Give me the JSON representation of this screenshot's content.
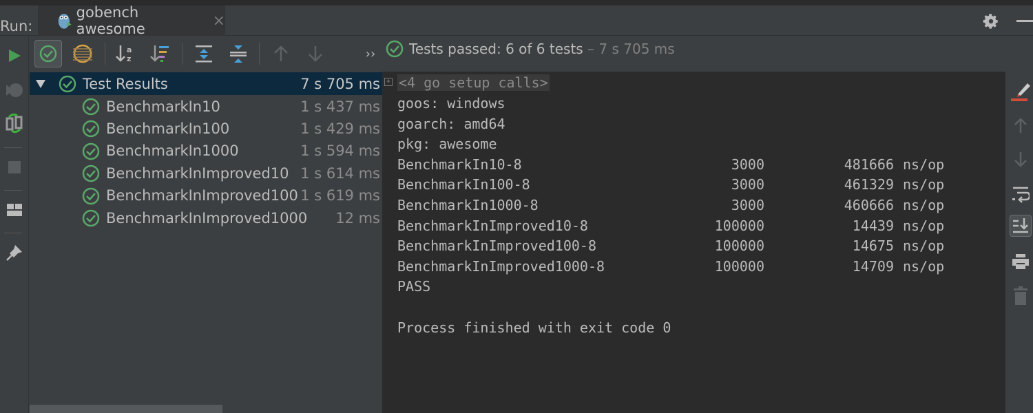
{
  "run_label": "Run:",
  "tab": {
    "title": "gobench awesome",
    "icon": "gopher-icon",
    "close": "×"
  },
  "status": {
    "prefix": "Tests passed: ",
    "passed": "6",
    "of_text": " of 6 tests",
    "duration": " – 7 s 705 ms",
    "more": "››"
  },
  "colors": {
    "pass": "#59a869",
    "selected_row": "#0d293e",
    "console_bg": "#2b2b2b",
    "panel_bg": "#3c3f41"
  },
  "tree": {
    "root": {
      "label": "Test Results",
      "time": "7 s 705 ms"
    },
    "items": [
      {
        "label": "BenchmarkIn10",
        "time": "1 s 437 ms"
      },
      {
        "label": "BenchmarkIn100",
        "time": "1 s 429 ms"
      },
      {
        "label": "BenchmarkIn1000",
        "time": "1 s 594 ms"
      },
      {
        "label": "BenchmarkInImproved10",
        "time": "1 s 614 ms"
      },
      {
        "label": "BenchmarkInImproved100",
        "time": "1 s 619 ms"
      },
      {
        "label": "BenchmarkInImproved1000",
        "time": "12 ms"
      }
    ]
  },
  "console": {
    "setup": "<4 go setup calls>",
    "lines": [
      "goos: windows",
      "goarch: amd64",
      "pkg: awesome"
    ],
    "bench": [
      {
        "name": "BenchmarkIn10-8",
        "n": "3000",
        "ns": "481666",
        "unit": "ns/op"
      },
      {
        "name": "BenchmarkIn100-8",
        "n": "3000",
        "ns": "461329",
        "unit": "ns/op"
      },
      {
        "name": "BenchmarkIn1000-8",
        "n": "3000",
        "ns": "460666",
        "unit": "ns/op"
      },
      {
        "name": "BenchmarkInImproved10-8",
        "n": "100000",
        "ns": "14439",
        "unit": "ns/op"
      },
      {
        "name": "BenchmarkInImproved100-8",
        "n": "100000",
        "ns": "14675",
        "unit": "ns/op"
      },
      {
        "name": "BenchmarkInImproved1000-8",
        "n": "100000",
        "ns": "14709",
        "unit": "ns/op"
      }
    ],
    "pass": "PASS",
    "finished": "Process finished with exit code 0"
  }
}
